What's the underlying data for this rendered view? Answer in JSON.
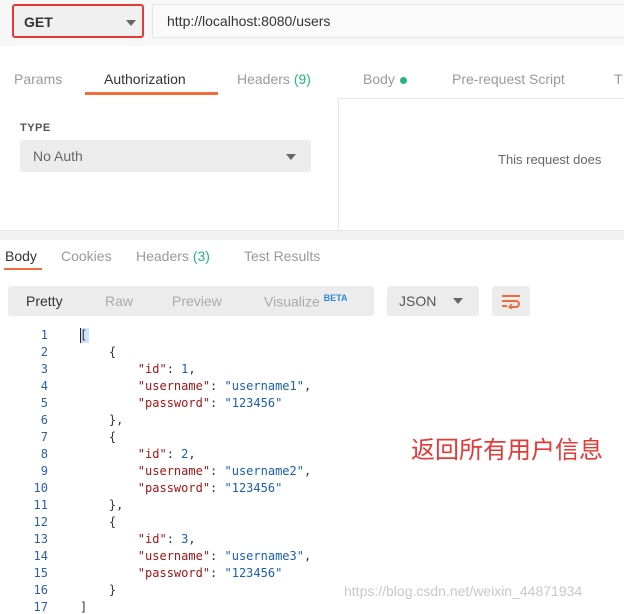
{
  "request": {
    "method": "GET",
    "url": "http://localhost:8080/users"
  },
  "request_tabs": {
    "params": "Params",
    "authorization": "Authorization",
    "headers": "Headers",
    "headers_count": "(9)",
    "body": "Body",
    "prerequest": "Pre-request Script",
    "tests_partial": "T"
  },
  "auth": {
    "type_label": "TYPE",
    "selected": "No Auth",
    "info_text": "This request does"
  },
  "response_tabs": {
    "body": "Body",
    "cookies": "Cookies",
    "headers": "Headers",
    "headers_count": "(3)",
    "test_results": "Test Results"
  },
  "format": {
    "pretty": "Pretty",
    "raw": "Raw",
    "preview": "Preview",
    "visualize": "Visualize",
    "beta": "BETA",
    "language": "JSON"
  },
  "code": {
    "line_numbers": [
      "1",
      "2",
      "3",
      "4",
      "5",
      "6",
      "7",
      "8",
      "9",
      "10",
      "11",
      "12",
      "13",
      "14",
      "15",
      "16",
      "17"
    ],
    "lines": [
      "[",
      "    {",
      "        \"id\": 1,",
      "        \"username\": \"username1\",",
      "        \"password\": \"123456\"",
      "    },",
      "    {",
      "        \"id\": 2,",
      "        \"username\": \"username2\",",
      "        \"password\": \"123456\"",
      "    },",
      "    {",
      "        \"id\": 3,",
      "        \"username\": \"username3\",",
      "        \"password\": \"123456\"",
      "    }",
      "]"
    ]
  },
  "annotation": "返回所有用户信息",
  "watermark": "https://blog.csdn.net/weixin_44871934",
  "colors": {
    "accent": "#f26b3a",
    "highlight": "#e53935",
    "success": "#26b47f"
  }
}
